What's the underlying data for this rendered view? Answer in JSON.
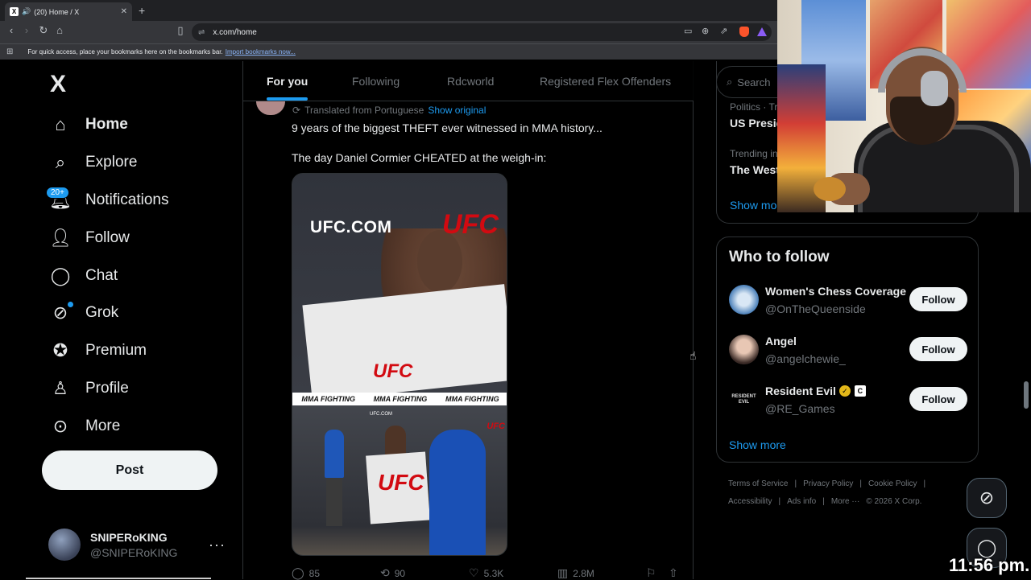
{
  "browser": {
    "tab_title": "(20) Home / X",
    "tab_favicon": "X",
    "url": "x.com/home",
    "bookmarks_message": "For quick access, place your bookmarks here on the bookmarks bar.",
    "bookmarks_link": "Import bookmarks now..."
  },
  "nav": {
    "logo": "X",
    "items": [
      {
        "label": "Home",
        "icon": "home-icon"
      },
      {
        "label": "Explore",
        "icon": "search-icon"
      },
      {
        "label": "Notifications",
        "icon": "bell-icon",
        "badge": "20+"
      },
      {
        "label": "Follow",
        "icon": "person-add-icon"
      },
      {
        "label": "Chat",
        "icon": "chat-icon"
      },
      {
        "label": "Grok",
        "icon": "grok-icon"
      },
      {
        "label": "Premium",
        "icon": "premium-icon"
      },
      {
        "label": "Profile",
        "icon": "profile-icon"
      },
      {
        "label": "More",
        "icon": "more-icon"
      }
    ],
    "post_button": "Post",
    "account": {
      "name": "SNIPERoKING",
      "handle": "@SNIPERoKING"
    }
  },
  "feed": {
    "tabs": [
      "For you",
      "Following",
      "Rdcworld",
      "Registered Flex Offenders"
    ],
    "active_tab": 0,
    "post": {
      "translated": "Translated from Portuguese",
      "show_original": "Show original",
      "text1": "9 years of the biggest THEFT ever witnessed in MMA history...",
      "text2": "The day Daniel Cormier CHEATED at the weigh-in:",
      "media": {
        "top_sign": "UFC.COM",
        "ufc_logo": "UFC",
        "strip": [
          "MMA FIGHTING",
          "MMA FIGHTING",
          "MMA FIGHTING"
        ],
        "bottom_small": "UFC.COM"
      },
      "stats": {
        "replies": "85",
        "reposts": "90",
        "likes": "5.3K",
        "views": "2.8M"
      }
    }
  },
  "sidebar": {
    "search_placeholder": "Search",
    "trends": [
      {
        "meta": "Politics · Trending",
        "title": "US Presidential"
      },
      {
        "meta": "Trending in",
        "title": "The West"
      }
    ],
    "trends_show_more": "Show more",
    "who_to_follow": {
      "title": "Who to follow",
      "accounts": [
        {
          "name": "Women's Chess Coverage",
          "handle": "@OnTheQueenside",
          "button": "Follow"
        },
        {
          "name": "Angel",
          "handle": "@angelchewie_",
          "button": "Follow"
        },
        {
          "name": "Resident Evil",
          "handle": "@RE_Games",
          "button": "Follow",
          "avatar_text": "RESIDENT EVIL"
        }
      ],
      "show_more": "Show more"
    },
    "footer": {
      "links_row1": [
        "Terms of Service",
        "Privacy Policy",
        "Cookie Policy"
      ],
      "links_row2": [
        "Accessibility",
        "Ads info",
        "More ···",
        "© 2026 X Corp."
      ]
    }
  },
  "overlay": {
    "clock": "11:56 pm."
  },
  "colors": {
    "accent": "#1d9bf0",
    "bg": "#000000",
    "muted": "#71767b",
    "ufc_red": "#d20a11"
  }
}
